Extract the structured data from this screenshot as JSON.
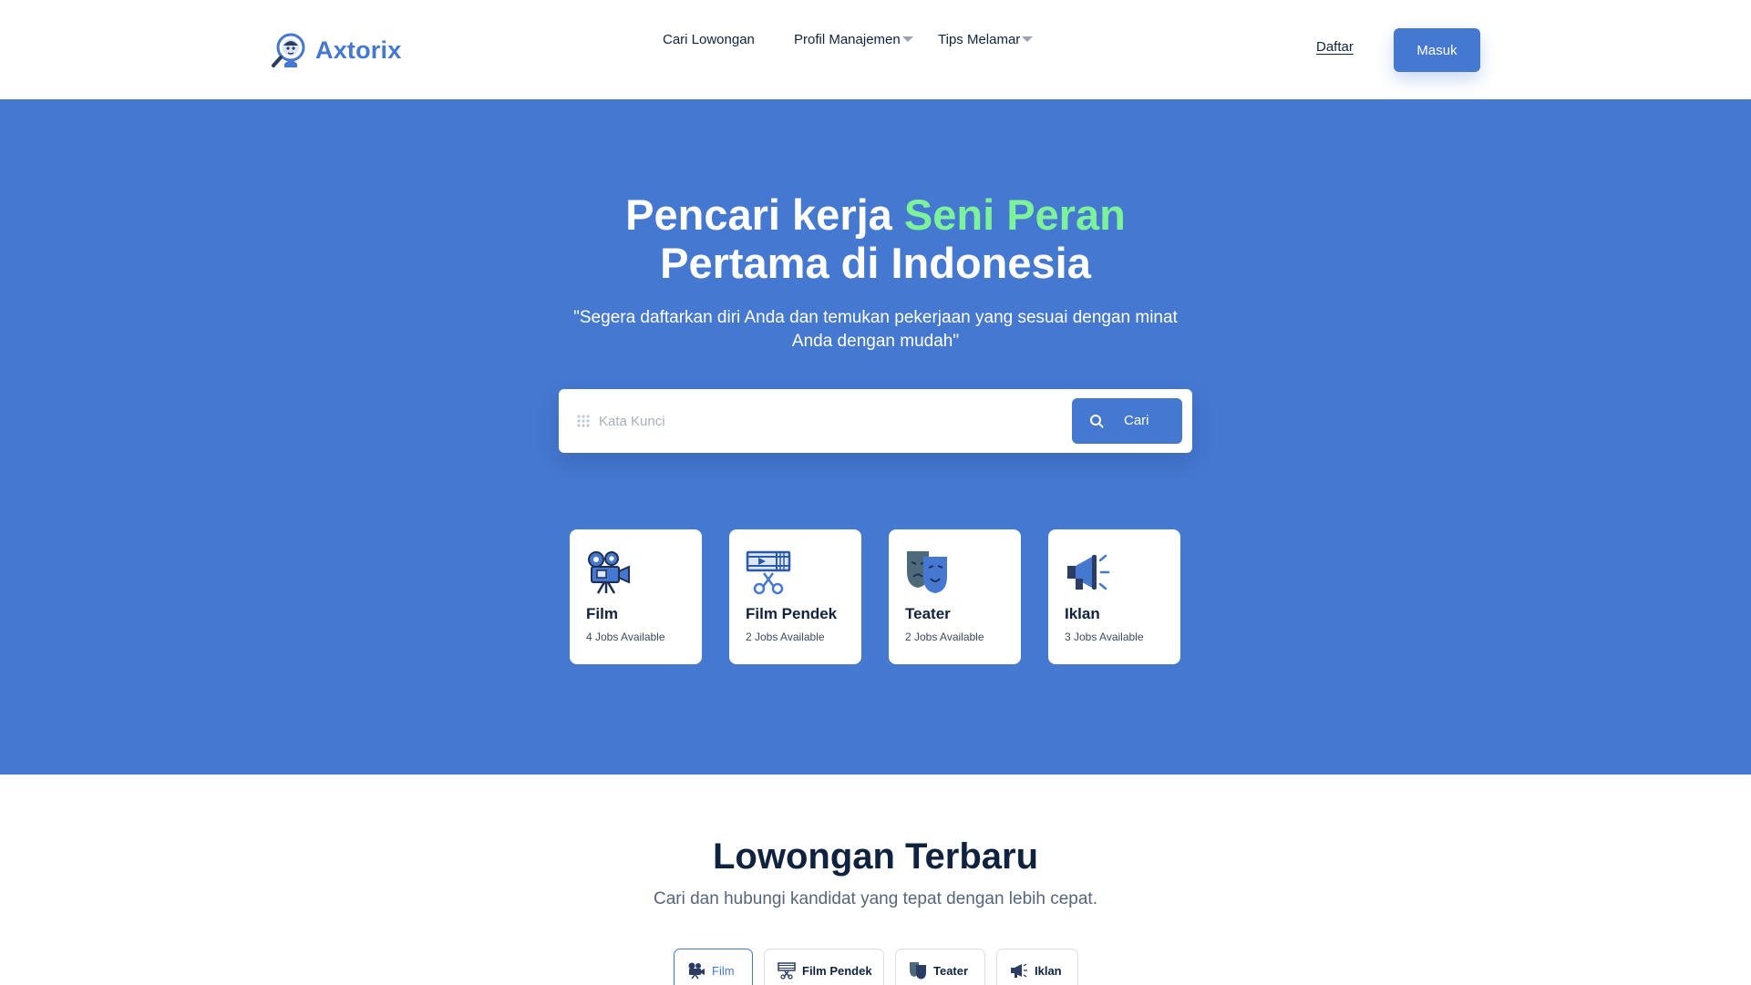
{
  "header": {
    "brand": "Axtorix",
    "nav": [
      {
        "label": "Cari Lowongan",
        "dropdown": false
      },
      {
        "label": "Profil Manajemen",
        "dropdown": true
      },
      {
        "label": "Tips Melamar",
        "dropdown": true
      }
    ],
    "daftar_label": "Daftar",
    "masuk_label": "Masuk"
  },
  "hero": {
    "title_line1_prefix": "Pencari kerja ",
    "title_line1_accent": "Seni Peran",
    "title_line2": "Pertama di Indonesia",
    "subtitle": "\"Segera daftarkan diri Anda dan temukan pekerjaan yang sesuai dengan minat Anda dengan mudah\"",
    "search": {
      "placeholder": "Kata Kunci",
      "value": "",
      "button_label": "Cari"
    },
    "categories": [
      {
        "name": "Film",
        "count": "4 Jobs Available",
        "icon": "movie-camera-icon"
      },
      {
        "name": "Film Pendek",
        "count": "2 Jobs Available",
        "icon": "film-editing-icon"
      },
      {
        "name": "Teater",
        "count": "2 Jobs Available",
        "icon": "theater-masks-icon"
      },
      {
        "name": "Iklan",
        "count": "3 Jobs Available",
        "icon": "megaphone-icon"
      }
    ]
  },
  "latest": {
    "title": "Lowongan Terbaru",
    "subtitle": "Cari dan hubungi kandidat yang tepat dengan lebih cepat.",
    "tabs": [
      {
        "label": "Film",
        "active": true,
        "icon": "movie-camera-icon"
      },
      {
        "label": "Film Pendek",
        "active": false,
        "icon": "film-editing-icon"
      },
      {
        "label": "Teater",
        "active": false,
        "icon": "theater-masks-icon"
      },
      {
        "label": "Iklan",
        "active": false,
        "icon": "megaphone-icon"
      }
    ]
  },
  "colors": {
    "primary": "#4578d1",
    "accent_green": "#7cf29a",
    "text_dark": "#0f2340",
    "icon_dark": "#2b3d63"
  }
}
